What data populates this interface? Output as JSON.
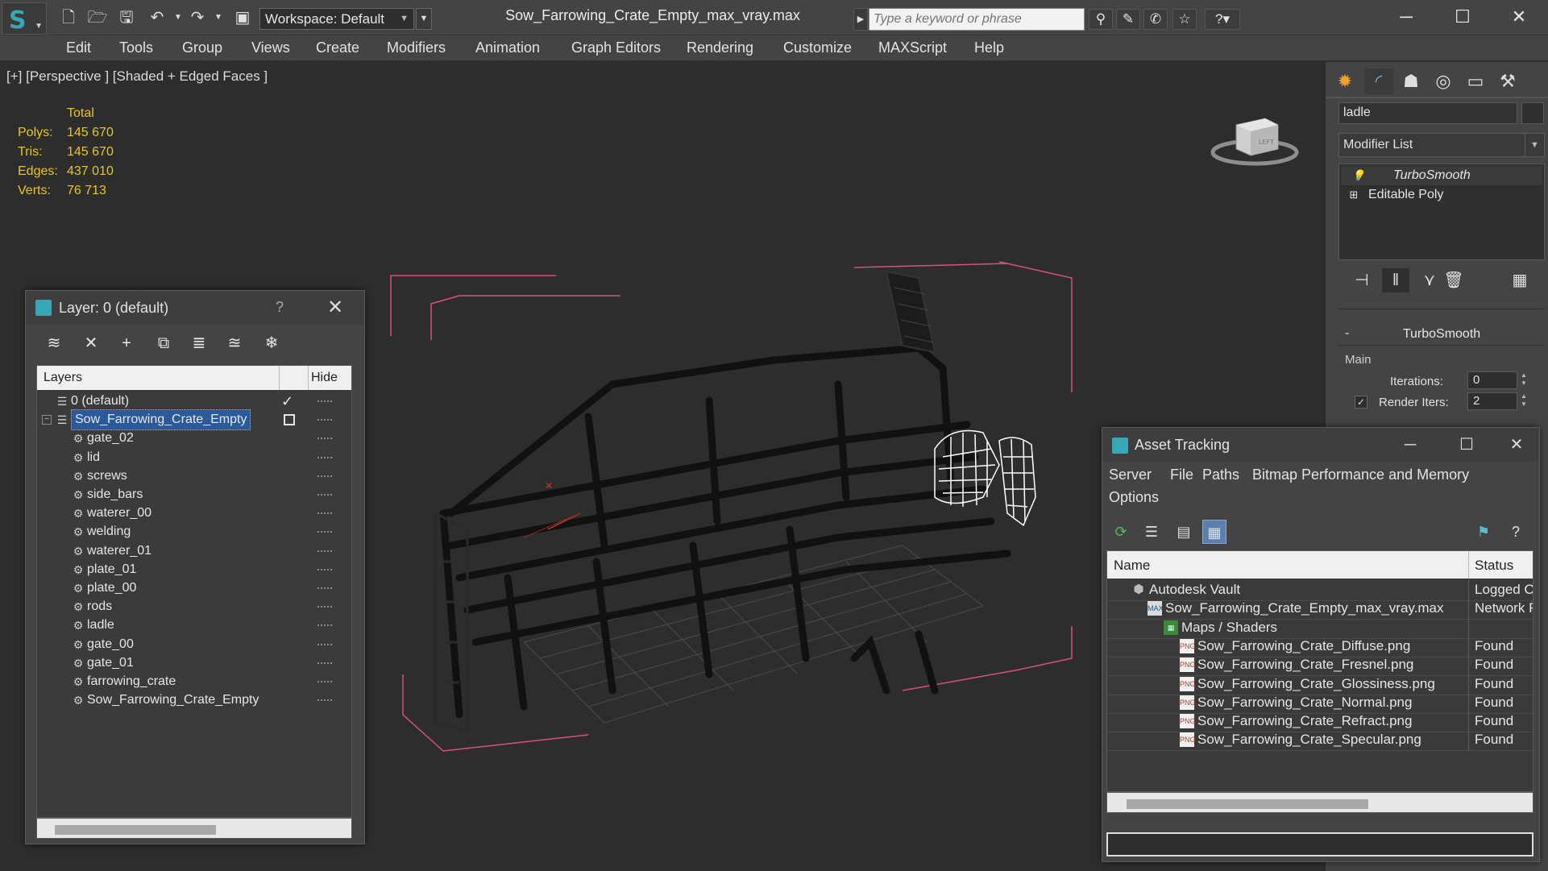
{
  "titlebar": {
    "workspace": "Workspace: Default",
    "file_title": "Sow_Farrowing_Crate_Empty_max_vray.max",
    "search_placeholder": "Type a keyword or phrase"
  },
  "menu": [
    "Edit",
    "Tools",
    "Group",
    "Views",
    "Create",
    "Modifiers",
    "Animation",
    "Graph Editors",
    "Rendering",
    "Customize",
    "MAXScript",
    "Help"
  ],
  "viewport": {
    "label": "[+] [Perspective ] [Shaded + Edged Faces ]",
    "stats": {
      "header": "Total",
      "rows": [
        {
          "label": "Polys:",
          "value": "145 670"
        },
        {
          "label": "Tris:",
          "value": "145 670"
        },
        {
          "label": "Edges:",
          "value": "437 010"
        },
        {
          "label": "Verts:",
          "value": "76 713"
        }
      ]
    },
    "viewcube_label": "LEFT"
  },
  "command_panel": {
    "object_name": "ladle",
    "modifier_list": "Modifier List",
    "stack": [
      {
        "name": "TurboSmooth"
      },
      {
        "name": "Editable Poly"
      }
    ],
    "rollout_title": "TurboSmooth",
    "group_main": "Main",
    "iterations_label": "Iterations:",
    "iterations_value": "0",
    "render_iters_label": "Render Iters:",
    "render_iters_value": "2",
    "render_iters_checked": true
  },
  "layer_dialog": {
    "title": "Layer: 0 (default)",
    "help": "?",
    "col_layers": "Layers",
    "col_hide": "Hide",
    "rows": [
      {
        "name": "0 (default)",
        "level": 0,
        "type": "layer",
        "active": true
      },
      {
        "name": "Sow_Farrowing_Crate_Empty",
        "level": 0,
        "type": "layer",
        "selected": true
      },
      {
        "name": "gate_02",
        "level": 1,
        "type": "object"
      },
      {
        "name": "lid",
        "level": 1,
        "type": "object"
      },
      {
        "name": "screws",
        "level": 1,
        "type": "object"
      },
      {
        "name": "side_bars",
        "level": 1,
        "type": "object"
      },
      {
        "name": "waterer_00",
        "level": 1,
        "type": "object"
      },
      {
        "name": "welding",
        "level": 1,
        "type": "object"
      },
      {
        "name": "waterer_01",
        "level": 1,
        "type": "object"
      },
      {
        "name": "plate_01",
        "level": 1,
        "type": "object"
      },
      {
        "name": "plate_00",
        "level": 1,
        "type": "object"
      },
      {
        "name": "rods",
        "level": 1,
        "type": "object"
      },
      {
        "name": "ladle",
        "level": 1,
        "type": "object"
      },
      {
        "name": "gate_00",
        "level": 1,
        "type": "object"
      },
      {
        "name": "gate_01",
        "level": 1,
        "type": "object"
      },
      {
        "name": "farrowing_crate",
        "level": 1,
        "type": "object"
      },
      {
        "name": "Sow_Farrowing_Crate_Empty",
        "level": 1,
        "type": "object"
      }
    ]
  },
  "asset_tracking": {
    "title": "Asset Tracking",
    "menu": [
      "Server",
      "File",
      "Paths",
      "Bitmap Performance and Memory",
      "Options"
    ],
    "col_name": "Name",
    "col_status": "Status",
    "rows": [
      {
        "name": "Autodesk Vault",
        "status": "Logged O",
        "level": 0,
        "icon": "vault"
      },
      {
        "name": "Sow_Farrowing_Crate_Empty_max_vray.max",
        "status": "Network F",
        "level": 1,
        "icon": "max"
      },
      {
        "name": "Maps / Shaders",
        "status": "",
        "level": 2,
        "icon": "maps"
      },
      {
        "name": "Sow_Farrowing_Crate_Diffuse.png",
        "status": "Found",
        "level": 3,
        "icon": "png"
      },
      {
        "name": "Sow_Farrowing_Crate_Fresnel.png",
        "status": "Found",
        "level": 3,
        "icon": "png"
      },
      {
        "name": "Sow_Farrowing_Crate_Glossiness.png",
        "status": "Found",
        "level": 3,
        "icon": "png"
      },
      {
        "name": "Sow_Farrowing_Crate_Normal.png",
        "status": "Found",
        "level": 3,
        "icon": "png"
      },
      {
        "name": "Sow_Farrowing_Crate_Refract.png",
        "status": "Found",
        "level": 3,
        "icon": "png"
      },
      {
        "name": "Sow_Farrowing_Crate_Specular.png",
        "status": "Found",
        "level": 3,
        "icon": "png"
      }
    ]
  },
  "colors": {
    "accent": "#37a7b5",
    "stats_text": "#e8c61f",
    "selection": "#2a5a9a",
    "bbox": "#d9507a"
  }
}
